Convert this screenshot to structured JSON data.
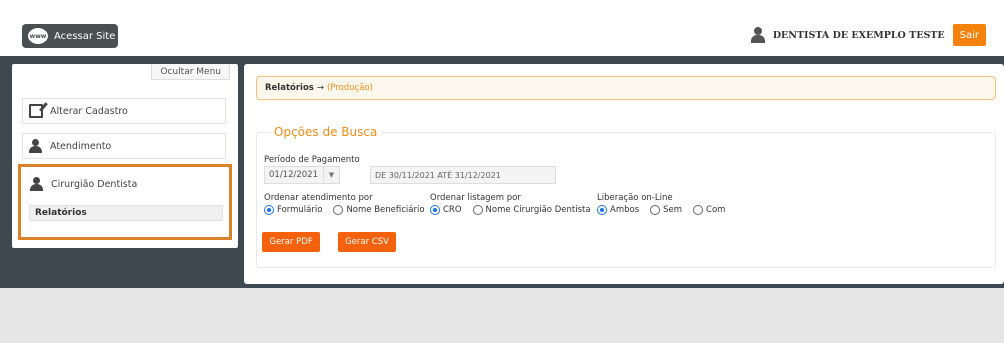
{
  "header": {
    "site_button": "Acessar Site",
    "www_label": "www",
    "user_name": "DENTISTA DE EXEMPLO TESTE",
    "logout": "Sair"
  },
  "sidebar": {
    "toggle": "Ocultar Menu",
    "items": [
      {
        "label": "Alterar Cadastro",
        "icon": "edit-icon"
      },
      {
        "label": "Atendimento",
        "icon": "user-speech-icon"
      },
      {
        "label": "Cirurgião Dentista",
        "icon": "dentist-icon"
      }
    ],
    "submenu": {
      "label": "Relatórios"
    },
    "highlight_color": "#d9822b"
  },
  "breadcrumb": {
    "main": "Relatórios",
    "arrow": "→",
    "sub": "(Produção)"
  },
  "search": {
    "legend": "Opções de Busca",
    "period_label": "Período de Pagamento",
    "period_value": "01/12/2021",
    "range_text": "DE 30/11/2021 ATÉ 31/12/2021",
    "order_attendance": {
      "label": "Ordenar atendimento por",
      "options": [
        "Formulário",
        "Nome Beneficiário"
      ],
      "selected": "Formulário"
    },
    "order_listing": {
      "label": "Ordenar listagem por",
      "options": [
        "CRO",
        "Nome Cirurgião Dentista"
      ],
      "selected": "CRO"
    },
    "release": {
      "label": "Liberação on-Line",
      "options": [
        "Ambos",
        "Sem",
        "Com"
      ],
      "selected": "Ambos"
    },
    "pdf_button": "Gerar PDF",
    "csv_button": "Gerar CSV"
  },
  "colors": {
    "accent": "#f5610c",
    "dark_band": "#3e4850",
    "legend": "#f08c1a"
  }
}
